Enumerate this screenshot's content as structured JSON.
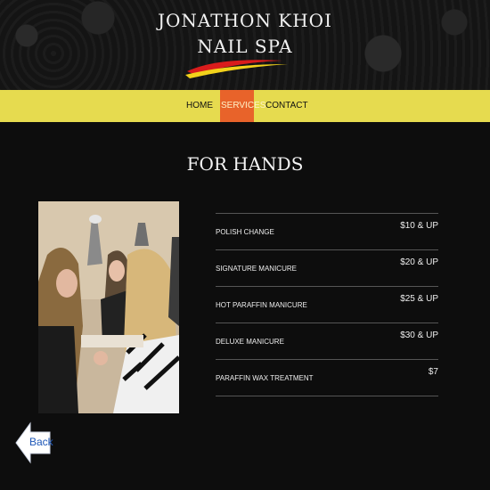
{
  "brand": {
    "line1": "JONATHON KHOI",
    "line2": "NAIL SPA"
  },
  "nav": {
    "items": [
      "HOME",
      "SERVICES",
      "CONTACT"
    ],
    "active": "SERVICES"
  },
  "page": {
    "title": "FOR HANDS"
  },
  "services": [
    {
      "name": "POLISH CHANGE",
      "price": "$10 & UP"
    },
    {
      "name": "SIGNATURE MANICURE",
      "price": "$20 & UP"
    },
    {
      "name": "HOT PARAFFIN MANICURE",
      "price": "$25 & UP"
    },
    {
      "name": "DELUXE MANICURE",
      "price": "$30 & UP"
    },
    {
      "name": "PARAFFIN WAX TREATMENT",
      "price": "$7"
    }
  ],
  "back": {
    "label": "Back"
  },
  "colors": {
    "nav_bg": "#e6db4f",
    "nav_active": "#e8632a",
    "page_bg": "#0d0d0d"
  }
}
